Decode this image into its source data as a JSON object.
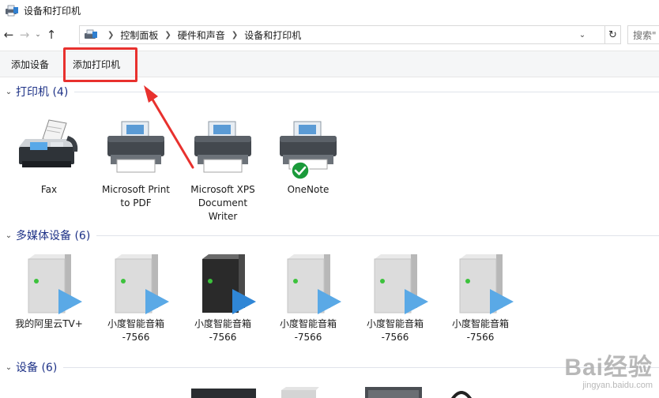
{
  "window": {
    "title": "设备和打印机"
  },
  "nav": {
    "breadcrumbs": [
      "控制面板",
      "硬件和声音",
      "设备和打印机"
    ],
    "search_placeholder": "搜索\""
  },
  "toolbar": {
    "add_device_label": "添加设备",
    "add_printer_label": "添加打印机"
  },
  "sections": {
    "printers": {
      "title": "打印机 (4)",
      "items": [
        {
          "label": "Fax",
          "icon": "fax-icon"
        },
        {
          "label": "Microsoft Print\nto PDF",
          "icon": "printer-icon"
        },
        {
          "label": "Microsoft XPS\nDocument\nWriter",
          "icon": "printer-icon"
        },
        {
          "label": "OneNote",
          "icon": "printer-icon",
          "default": true
        }
      ]
    },
    "media": {
      "title": "多媒体设备 (6)",
      "items": [
        {
          "label": "我的阿里云TV+",
          "icon": "media-server-icon",
          "dark": false
        },
        {
          "label": "小度智能音箱\n-7566",
          "icon": "media-server-icon",
          "dark": false
        },
        {
          "label": "小度智能音箱\n-7566",
          "icon": "media-server-icon",
          "dark": true
        },
        {
          "label": "小度智能音箱\n-7566",
          "icon": "media-server-icon",
          "dark": false
        },
        {
          "label": "小度智能音箱\n-7566",
          "icon": "media-server-icon",
          "dark": false
        },
        {
          "label": "小度智能音箱\n-7566",
          "icon": "media-server-icon",
          "dark": false
        }
      ]
    },
    "devices": {
      "title": "设备 (6)"
    }
  },
  "watermark": {
    "line1": "Bai经验",
    "line2": "jingyan.baidu.com"
  },
  "colors": {
    "accent_red": "#e8312e",
    "section_title": "#1e3287",
    "default_check": "#1a9a3a",
    "play_arrow": "#4a9fe0"
  }
}
